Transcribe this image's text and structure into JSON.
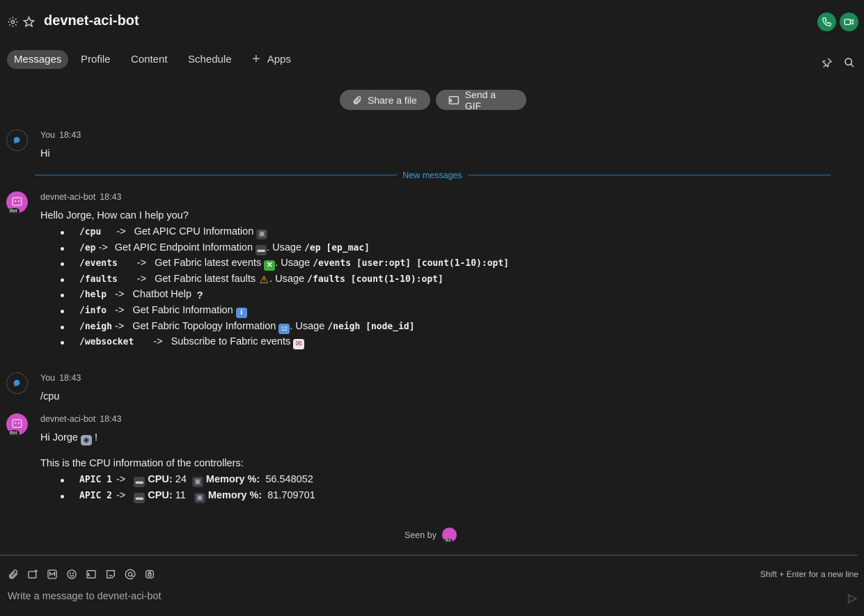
{
  "header": {
    "title": "devnet-aci-bot",
    "tabs": [
      "Messages",
      "Profile",
      "Content",
      "Schedule",
      "Apps"
    ],
    "active_tab": "Messages",
    "accent": "#1c8a57"
  },
  "actions": {
    "share_file": "Share a file",
    "send_gif": "Send a GIF"
  },
  "divider_label": "New messages",
  "messages": [
    {
      "sender": "You",
      "time": "18:43",
      "text": "Hi"
    },
    {
      "sender": "devnet-aci-bot",
      "time": "18:43",
      "intro": "Hello Jorge, How can I help you?",
      "commands": [
        {
          "cmd": "/cpu",
          "arrow": "->",
          "desc": "Get APIC CPU Information",
          "emoji": "floppy-disk",
          "usage_label": "",
          "usage": ""
        },
        {
          "cmd": "/ep",
          "arrow": "->",
          "desc": "Get APIC Endpoint Information",
          "emoji": "laptop",
          "usage_label": ". Usage",
          "usage": "/ep [ep_mac]"
        },
        {
          "cmd": "/events",
          "arrow": "->",
          "desc": "Get Fabric latest events",
          "emoji": "cross-mark-button",
          "usage_label": ".  Usage",
          "usage": "/events [user:opt] [count(1-10):opt]"
        },
        {
          "cmd": "/faults",
          "arrow": "->",
          "desc": "Get Fabric latest faults",
          "emoji": "warning",
          "usage_label": ". Usage",
          "usage": "/faults [count(1-10):opt]"
        },
        {
          "cmd": "/help",
          "arrow": "->",
          "desc": "Chatbot Help",
          "emoji": "question-mark",
          "usage_label": "",
          "usage": ""
        },
        {
          "cmd": "/info",
          "arrow": "->",
          "desc": "Get Fabric Information",
          "emoji": "information",
          "usage_label": "",
          "usage": ""
        },
        {
          "cmd": "/neigh",
          "arrow": "->",
          "desc": "Get Fabric Topology Information",
          "emoji": "input-numbers",
          "usage_label": ". Usage",
          "usage": "/neigh [node_id]"
        },
        {
          "cmd": "/websocket",
          "arrow": "->",
          "desc": "Subscribe to Fabric events",
          "emoji": "envelope-with-arrow",
          "usage_label": "",
          "usage": ""
        }
      ]
    },
    {
      "sender": "You",
      "time": "18:43",
      "text": "/cpu"
    },
    {
      "sender": "devnet-aci-bot",
      "time": "18:43",
      "greeting": "Hi Jorge",
      "greeting_end": "!",
      "greeting_emoji": "robot",
      "cpu_intro": "This is the CPU information of the controllers:",
      "controllers": [
        {
          "name": "APIC 1",
          "arrow": "->",
          "cpu_label": "CPU:",
          "cpu": "24",
          "mem_label": "Memory %:",
          "mem": "56.548052"
        },
        {
          "name": "APIC 2",
          "arrow": "->",
          "cpu_label": "CPU:",
          "cpu": "11",
          "mem_label": "Memory %:",
          "mem": "81.709701"
        }
      ]
    }
  ],
  "seen_by_label": "Seen by",
  "composer": {
    "hint": "Shift + Enter for a new line",
    "placeholder": "Write a message to devnet-aci-bot",
    "tools": [
      "paperclip-icon",
      "screen-capture-icon",
      "markdown-icon",
      "emoji-icon",
      "gif-icon",
      "sticker-icon",
      "mention-icon",
      "lock-icon"
    ]
  }
}
